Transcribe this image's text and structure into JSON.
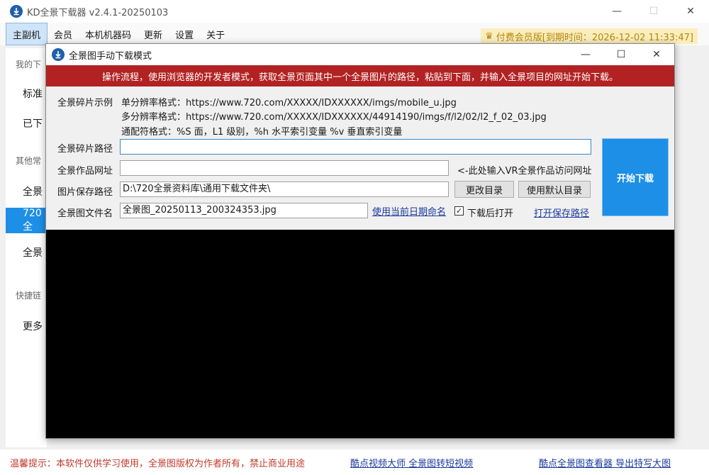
{
  "app": {
    "title": "KD全景下载器 v2.4.1-20250103",
    "minimize": "—",
    "maximize": "☐",
    "close": "✕"
  },
  "menu": {
    "items": [
      "主副机",
      "会员",
      "本机机器码",
      "更新",
      "设置",
      "关于"
    ]
  },
  "vip_badge": "付费会员版[到期时间：2026-12-02 11:33:47]",
  "sidebar": {
    "section_mine": "我的下",
    "item_standard": "标准",
    "item_done": "已下",
    "section_other": "其他常",
    "item_pano1": "全景",
    "item_720": "720全",
    "item_pano2": "全景",
    "section_quick": "快捷链",
    "item_more": "更多"
  },
  "dialog": {
    "title": "全景图手动下载模式",
    "minimize": "—",
    "maximize": "☐",
    "close": "✕",
    "banner": "操作流程，使用浏览器的开发者模式，获取全景页面其中一个全景图片的路径，粘贴到下面，并输入全景项目的网址开始下载。",
    "example_label": "全景碎片示例",
    "example_single": "单分辨率格式：https://www.720.com/XXXXX/IDXXXXXX/imgs/mobile_u.jpg",
    "example_multi": "多分辨率格式：https://www.720.com/XXXXX/IDXXXXXX/44914190/imgs/f/l2/02/l2_f_02_03.jpg",
    "example_wildcard": "通配符格式：%S 面，L1 级别，%h 水平索引变量 %v 垂直索引变量",
    "path_label": "全景碎片路径",
    "path_value": "",
    "url_label": "全景作品网址",
    "url_value": "",
    "url_hint": "<-此处输入VR全景作品访问网址",
    "save_label": "图片保存路径",
    "save_value": "D:\\720全景资料库\\通用下载文件夹\\",
    "change_dir": "更改目录",
    "default_dir": "使用默认目录",
    "filename_label": "全景图文件名",
    "filename_value": "全景图_20250113_200324353.jpg",
    "date_name_link": "使用当前日期命名",
    "open_after_check": "✓",
    "open_after_label": "下载后打开",
    "open_path_link": "打开保存路径",
    "start_button": "开始下载"
  },
  "bottom": {
    "tip": "温馨提示：本软件仅供学习使用，全景图版权为作者所有，禁止商业用途",
    "link_video": "酷点视频大师 全景图转短视频",
    "link_viewer": "酷点全景图查看器 导出特写大图"
  },
  "colors": {
    "accent": "#1e8fe6",
    "banner": "#b22222",
    "link": "#1a3a9c",
    "tip": "#c0392b",
    "vip_bg": "#fbeebd"
  }
}
